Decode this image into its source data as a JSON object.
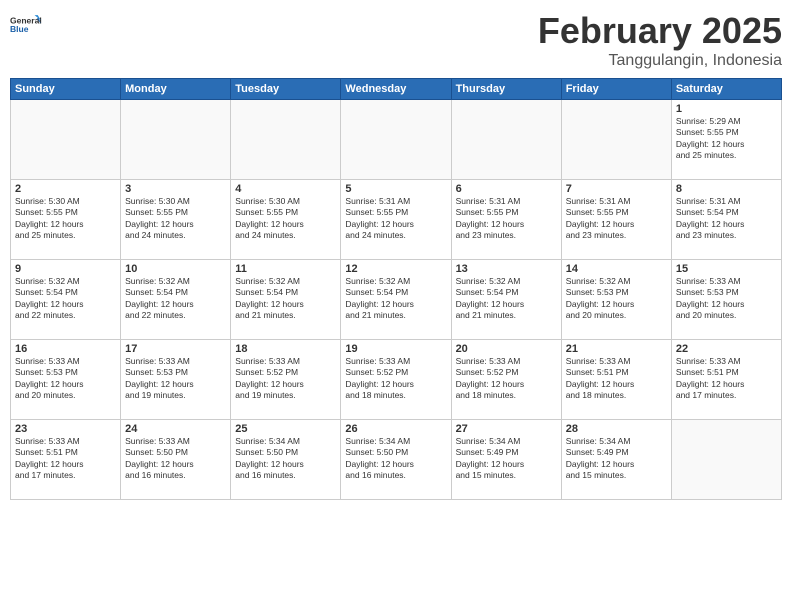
{
  "header": {
    "logo_line1": "General",
    "logo_line2": "Blue",
    "month_year": "February 2025",
    "location": "Tanggulangin, Indonesia"
  },
  "weekdays": [
    "Sunday",
    "Monday",
    "Tuesday",
    "Wednesday",
    "Thursday",
    "Friday",
    "Saturday"
  ],
  "weeks": [
    [
      {
        "day": "",
        "info": ""
      },
      {
        "day": "",
        "info": ""
      },
      {
        "day": "",
        "info": ""
      },
      {
        "day": "",
        "info": ""
      },
      {
        "day": "",
        "info": ""
      },
      {
        "day": "",
        "info": ""
      },
      {
        "day": "1",
        "info": "Sunrise: 5:29 AM\nSunset: 5:55 PM\nDaylight: 12 hours\nand 25 minutes."
      }
    ],
    [
      {
        "day": "2",
        "info": "Sunrise: 5:30 AM\nSunset: 5:55 PM\nDaylight: 12 hours\nand 25 minutes."
      },
      {
        "day": "3",
        "info": "Sunrise: 5:30 AM\nSunset: 5:55 PM\nDaylight: 12 hours\nand 24 minutes."
      },
      {
        "day": "4",
        "info": "Sunrise: 5:30 AM\nSunset: 5:55 PM\nDaylight: 12 hours\nand 24 minutes."
      },
      {
        "day": "5",
        "info": "Sunrise: 5:31 AM\nSunset: 5:55 PM\nDaylight: 12 hours\nand 24 minutes."
      },
      {
        "day": "6",
        "info": "Sunrise: 5:31 AM\nSunset: 5:55 PM\nDaylight: 12 hours\nand 23 minutes."
      },
      {
        "day": "7",
        "info": "Sunrise: 5:31 AM\nSunset: 5:55 PM\nDaylight: 12 hours\nand 23 minutes."
      },
      {
        "day": "8",
        "info": "Sunrise: 5:31 AM\nSunset: 5:54 PM\nDaylight: 12 hours\nand 23 minutes."
      }
    ],
    [
      {
        "day": "9",
        "info": "Sunrise: 5:32 AM\nSunset: 5:54 PM\nDaylight: 12 hours\nand 22 minutes."
      },
      {
        "day": "10",
        "info": "Sunrise: 5:32 AM\nSunset: 5:54 PM\nDaylight: 12 hours\nand 22 minutes."
      },
      {
        "day": "11",
        "info": "Sunrise: 5:32 AM\nSunset: 5:54 PM\nDaylight: 12 hours\nand 21 minutes."
      },
      {
        "day": "12",
        "info": "Sunrise: 5:32 AM\nSunset: 5:54 PM\nDaylight: 12 hours\nand 21 minutes."
      },
      {
        "day": "13",
        "info": "Sunrise: 5:32 AM\nSunset: 5:54 PM\nDaylight: 12 hours\nand 21 minutes."
      },
      {
        "day": "14",
        "info": "Sunrise: 5:32 AM\nSunset: 5:53 PM\nDaylight: 12 hours\nand 20 minutes."
      },
      {
        "day": "15",
        "info": "Sunrise: 5:33 AM\nSunset: 5:53 PM\nDaylight: 12 hours\nand 20 minutes."
      }
    ],
    [
      {
        "day": "16",
        "info": "Sunrise: 5:33 AM\nSunset: 5:53 PM\nDaylight: 12 hours\nand 20 minutes."
      },
      {
        "day": "17",
        "info": "Sunrise: 5:33 AM\nSunset: 5:53 PM\nDaylight: 12 hours\nand 19 minutes."
      },
      {
        "day": "18",
        "info": "Sunrise: 5:33 AM\nSunset: 5:52 PM\nDaylight: 12 hours\nand 19 minutes."
      },
      {
        "day": "19",
        "info": "Sunrise: 5:33 AM\nSunset: 5:52 PM\nDaylight: 12 hours\nand 18 minutes."
      },
      {
        "day": "20",
        "info": "Sunrise: 5:33 AM\nSunset: 5:52 PM\nDaylight: 12 hours\nand 18 minutes."
      },
      {
        "day": "21",
        "info": "Sunrise: 5:33 AM\nSunset: 5:51 PM\nDaylight: 12 hours\nand 18 minutes."
      },
      {
        "day": "22",
        "info": "Sunrise: 5:33 AM\nSunset: 5:51 PM\nDaylight: 12 hours\nand 17 minutes."
      }
    ],
    [
      {
        "day": "23",
        "info": "Sunrise: 5:33 AM\nSunset: 5:51 PM\nDaylight: 12 hours\nand 17 minutes."
      },
      {
        "day": "24",
        "info": "Sunrise: 5:33 AM\nSunset: 5:50 PM\nDaylight: 12 hours\nand 16 minutes."
      },
      {
        "day": "25",
        "info": "Sunrise: 5:34 AM\nSunset: 5:50 PM\nDaylight: 12 hours\nand 16 minutes."
      },
      {
        "day": "26",
        "info": "Sunrise: 5:34 AM\nSunset: 5:50 PM\nDaylight: 12 hours\nand 16 minutes."
      },
      {
        "day": "27",
        "info": "Sunrise: 5:34 AM\nSunset: 5:49 PM\nDaylight: 12 hours\nand 15 minutes."
      },
      {
        "day": "28",
        "info": "Sunrise: 5:34 AM\nSunset: 5:49 PM\nDaylight: 12 hours\nand 15 minutes."
      },
      {
        "day": "",
        "info": ""
      }
    ]
  ]
}
